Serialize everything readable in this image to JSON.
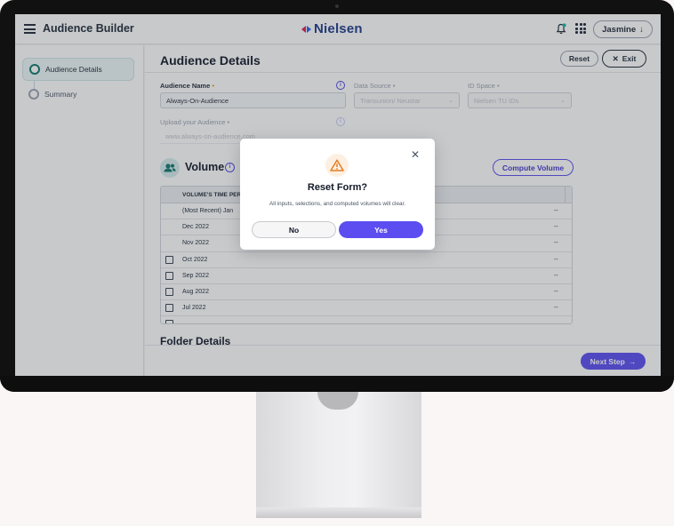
{
  "app": {
    "title": "Audience Builder",
    "brand": "Nielsen",
    "user": "Jasmine"
  },
  "sidebar": {
    "steps": [
      {
        "label": "Audience Details",
        "active": true
      },
      {
        "label": "Summary",
        "active": false
      }
    ]
  },
  "main": {
    "title": "Audience Details",
    "reset_label": "Reset",
    "exit_label": "Exit",
    "form": {
      "audience_name_label": "Audience Name",
      "audience_name_value": "Always-On-Audience",
      "data_source_label": "Data Source",
      "data_source_value": "Transunion/ Neustar",
      "id_space_label": "ID Space",
      "id_space_value": "Nielsen TU IDs",
      "upload_label": "Upload your Audience",
      "upload_value": "www.always-on-audience.com"
    },
    "volume": {
      "title": "Volume",
      "compute_label": "Compute Volume",
      "column_header": "VOLUME'S TIME PERI",
      "rows": [
        {
          "period": "(Most Recent) Jan",
          "value": "--",
          "checkbox": false
        },
        {
          "period": "Dec 2022",
          "value": "--",
          "checkbox": false
        },
        {
          "period": "Nov 2022",
          "value": "--",
          "checkbox": false
        },
        {
          "period": "Oct 2022",
          "value": "--",
          "checkbox": true
        },
        {
          "period": "Sep 2022",
          "value": "--",
          "checkbox": true
        },
        {
          "period": "Aug 2022",
          "value": "--",
          "checkbox": true
        },
        {
          "period": "Jul 2022",
          "value": "--",
          "checkbox": true
        }
      ]
    },
    "folder_details_title": "Folder Details"
  },
  "footer": {
    "next_label": "Next Step"
  },
  "modal": {
    "title": "Reset Form?",
    "message": "All inputs, selections, and computed volumes will clear.",
    "no_label": "No",
    "yes_label": "Yes"
  },
  "colors": {
    "accent": "#5b4df0",
    "teal": "#0f766e",
    "brand_navy": "#1e3a8a",
    "warning": "#e67e22"
  }
}
